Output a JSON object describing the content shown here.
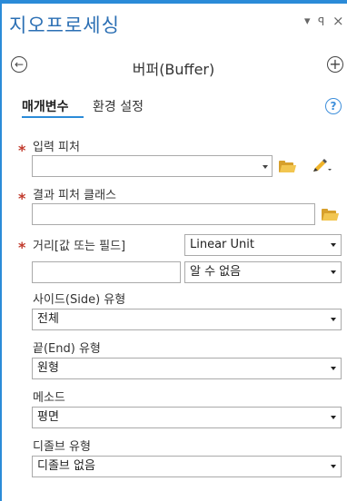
{
  "pane": {
    "title": "지오프로세싱",
    "ctrl_menu": "▾",
    "ctrl_pin": "ꟼ",
    "ctrl_close": "×"
  },
  "tool": {
    "title": "버퍼(Buffer)",
    "back_glyph": "←",
    "add_glyph": "+"
  },
  "tabs": {
    "parameters": "매개변수",
    "environments": "환경 설정",
    "help_glyph": "?"
  },
  "fields": {
    "input_features": {
      "label": "입력 피처",
      "value": ""
    },
    "output_class": {
      "label": "결과 피처 클래스",
      "value": ""
    },
    "distance": {
      "label": "거리[값 또는 필드]",
      "type_value": "Linear Unit",
      "value": "",
      "unit_value": "알 수 없음"
    },
    "side_type": {
      "label": "사이드(Side) 유형",
      "value": "전체"
    },
    "end_type": {
      "label": "끝(End) 유형",
      "value": "원형"
    },
    "method": {
      "label": "메소드",
      "value": "평면"
    },
    "dissolve_type": {
      "label": "디졸브 유형",
      "value": "디졸브 없음"
    }
  },
  "colors": {
    "accent": "#2b8bd8",
    "required": "#c1392b",
    "title": "#2b6fb4",
    "folder": "#d7a02c"
  }
}
